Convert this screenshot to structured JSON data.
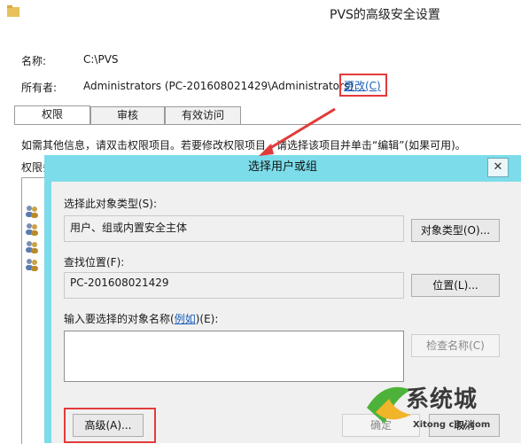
{
  "window": {
    "title": "PVS的高级安全设置",
    "name_label": "名称:",
    "name_value": "C:\\PVS",
    "owner_label": "所有者:",
    "owner_value": "Administrators (PC-201608021429\\Administrators)",
    "owner_change_link": "更改(C)"
  },
  "tabs": [
    {
      "label": "权限"
    },
    {
      "label": "审核"
    },
    {
      "label": "有效访问"
    }
  ],
  "info_text": "如需其他信息，请双击权限项目。若要修改权限项目，请选择该项目并单击“编辑”(如果可用)。",
  "perm_label": "权限条",
  "dialog": {
    "title": "选择用户或组",
    "close": "✕",
    "object_type_label": "选择此对象类型(S):",
    "object_type_value": "用户、组或内置安全主体",
    "object_type_button": "对象类型(O)...",
    "location_label": "查找位置(F):",
    "location_value": "PC-201608021429",
    "location_button": "位置(L)...",
    "enter_label_prefix": "输入要选择的对象名称(",
    "enter_label_link": "例如",
    "enter_label_suffix": ")(E):",
    "check_names_button": "检查名称(C)",
    "advanced_button": "高级(A)...",
    "ok_button": "确定",
    "cancel_button": "取消"
  },
  "watermark": {
    "text": "系统城",
    "sub": "Xitong city.com"
  },
  "colors": {
    "dialog_frame": "#7cdcea",
    "highlight_box": "#e23a3a",
    "link": "#1c5fb8"
  }
}
